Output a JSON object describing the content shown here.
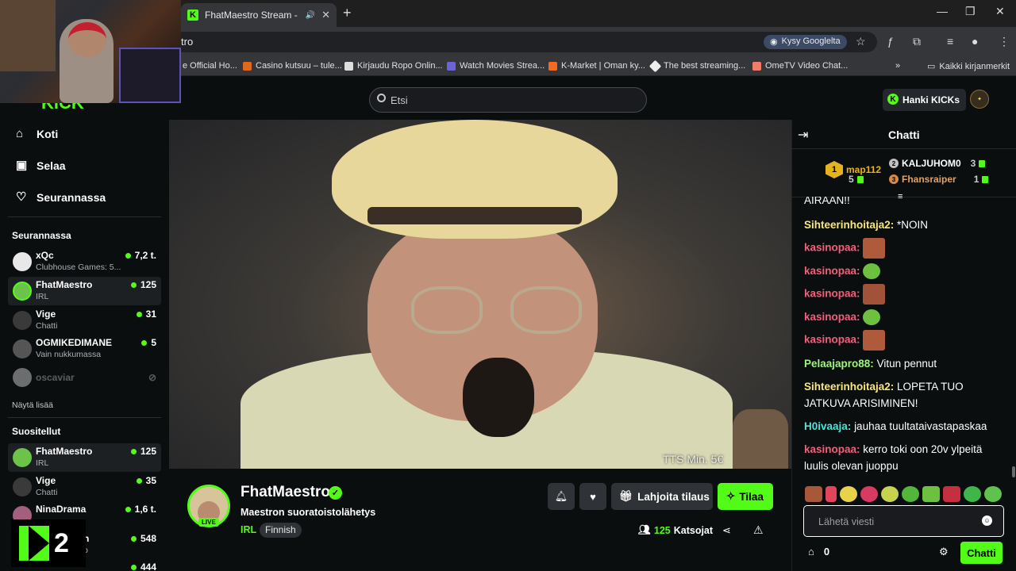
{
  "browser": {
    "tab_title": "FhatMaestro Stream - Watc",
    "address_fragment": "tro",
    "kysy_label": "Kysy Googlelta",
    "bookmarks": [
      "e Official Ho...",
      "Casino kutsuu – tule...",
      "Kirjaudu Ropo Onlin...",
      "Watch Movies Strea...",
      "K-Market | Oman ky...",
      "The best streaming...",
      "OmeTV Video Chat...",
      "Kaikki kirjanmerkit"
    ]
  },
  "header": {
    "search_placeholder": "Etsi",
    "get_kicks_label": "Hanki KICKs"
  },
  "sidebar": {
    "nav": [
      {
        "label": "Koti",
        "icon": "home-icon"
      },
      {
        "label": "Selaa",
        "icon": "browse-icon"
      },
      {
        "label": "Seurannassa",
        "icon": "heart-icon"
      }
    ],
    "following_title": "Seurannassa",
    "following": [
      {
        "name": "xQc",
        "sub": "Clubhouse Games: 5...",
        "count": "7,2 t."
      },
      {
        "name": "FhatMaestro",
        "sub": "IRL",
        "count": "125"
      },
      {
        "name": "Vige",
        "sub": "Chatti",
        "count": "31"
      },
      {
        "name": "OGMIKEDIMANE",
        "sub": "Vain nukkumassa",
        "count": "5"
      },
      {
        "name": "oscaviar",
        "sub": "",
        "count": ""
      }
    ],
    "show_more": "Näytä lisää",
    "recommended_title": "Suositellut",
    "recommended": [
      {
        "name": "FhatMaestro",
        "sub": "IRL",
        "count": "125"
      },
      {
        "name": "Vige",
        "sub": "Chatti",
        "count": "35"
      },
      {
        "name": "NinaDrama",
        "sub": "",
        "count": "1,6 t."
      },
      {
        "name": "n",
        "sub": "o",
        "count": "548"
      },
      {
        "name": "",
        "sub": "",
        "count": "444"
      }
    ],
    "k2_label": "2"
  },
  "video": {
    "overlay_text": "TTS Min. 5€"
  },
  "stream": {
    "name": "FhatMaestro",
    "live_label": "LIVE",
    "title": "Maestron suoratoistolähetys",
    "category": "IRL",
    "tag": "Finnish",
    "gift_label": "Lahjoita tilaus",
    "subscribe_label": "Tilaa",
    "viewers": "125",
    "viewers_label": "Katsojat"
  },
  "chat": {
    "title": "Chatti",
    "leaderboard": {
      "first": {
        "rank": "1",
        "name": "map112",
        "value": "5"
      },
      "second": {
        "rank": "2",
        "name": "KALJUHOM0",
        "value": "3"
      },
      "third": {
        "rank": "3",
        "name": "Fhansraiper",
        "value": "1"
      }
    },
    "messages": [
      {
        "user": "",
        "text": "AIRAAN!!"
      },
      {
        "user": "Sihteerinhoitaja2:",
        "text": "*NOIN"
      },
      {
        "user": "kasinopaa:",
        "text": ""
      },
      {
        "user": "kasinopaa:",
        "text": ""
      },
      {
        "user": "kasinopaa:",
        "text": ""
      },
      {
        "user": "kasinopaa:",
        "text": ""
      },
      {
        "user": "kasinopaa:",
        "text": ""
      },
      {
        "user": "Pelaajapro88:",
        "text": "Vitun pennut"
      },
      {
        "user": "Sihteerinhoitaja2:",
        "text": "LOPETA TUO JATKUVA ARISIMINEN!"
      },
      {
        "user": "H0ivaaja:",
        "text": "jauhaa tuultataivastapaskaa"
      },
      {
        "user": "kasinopaa:",
        "text": "kerro toki oon 20v ylpeitä luulis olevan juoppu"
      }
    ],
    "input_placeholder": "Lähetä viesti",
    "points": "0",
    "send_label": "Chatti"
  },
  "colors": {
    "accent": "#53fc18",
    "background": "#0b0e0f",
    "kasinopaa": "#f45d7b",
    "sihteeri": "#f6e879",
    "pelaaja": "#9ef57a",
    "hoivaaja": "#4ee3d5"
  }
}
